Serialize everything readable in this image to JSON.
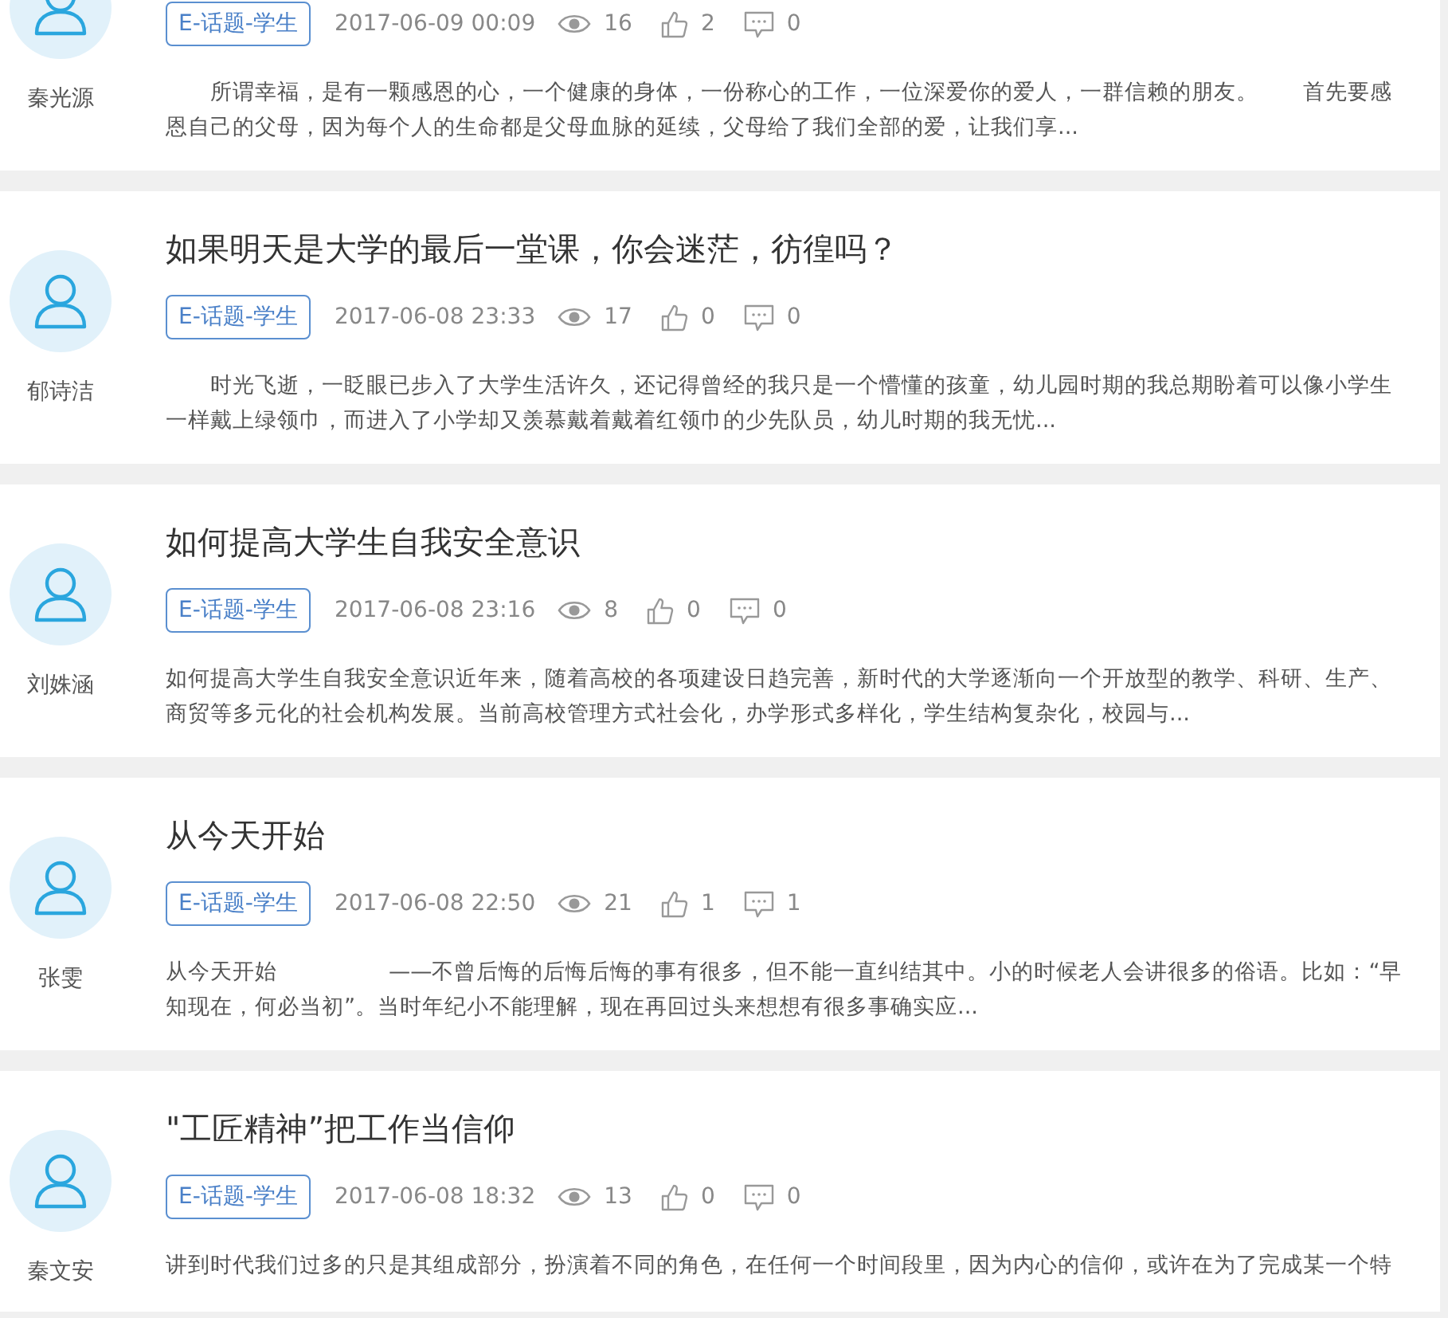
{
  "posts": [
    {
      "author": "秦光源",
      "tag": "E-话题-学生",
      "date": "2017-06-09 00:09",
      "views": "16",
      "likes": "2",
      "comments": "0",
      "excerpt": "　　所谓幸福，是有一颗感恩的心，一个健康的身体，一份称心的工作，一位深爱你的爱人，一群信赖的朋友。　　首先要感恩自己的父母，因为每个人的生命都是父母血脉的延续，父母给了我们全部的爱，让我们享..."
    },
    {
      "author": "郁诗洁",
      "title": "如果明天是大学的最后一堂课，你会迷茫，彷徨吗？",
      "tag": "E-话题-学生",
      "date": "2017-06-08 23:33",
      "views": "17",
      "likes": "0",
      "comments": "0",
      "excerpt": "　　时光飞逝，一眨眼已步入了大学生活许久，还记得曾经的我只是一个懵懂的孩童，幼儿园时期的我总期盼着可以像小学生一样戴上绿领巾，而进入了小学却又羡慕戴着戴着红领巾的少先队员，幼儿时期的我无忧..."
    },
    {
      "author": "刘姝涵",
      "title": "如何提高大学生自我安全意识",
      "tag": "E-话题-学生",
      "date": "2017-06-08 23:16",
      "views": "8",
      "likes": "0",
      "comments": "0",
      "excerpt": "如何提高大学生自我安全意识近年来，随着高校的各项建设日趋完善，新时代的大学逐渐向一个开放型的教学、科研、生产、商贸等多元化的社会机构发展。当前高校管理方式社会化，办学形式多样化，学生结构复杂化，校园与..."
    },
    {
      "author": "张雯",
      "title": "从今天开始",
      "tag": "E-话题-学生",
      "date": "2017-06-08 22:50",
      "views": "21",
      "likes": "1",
      "comments": "1",
      "excerpt": "从今天开始　　　　　——不曾后悔的后悔后悔的事有很多，但不能一直纠结其中。小的时候老人会讲很多的俗语。比如：“早知现在，何必当初”。当时年纪小不能理解，现在再回过头来想想有很多事确实应..."
    },
    {
      "author": "秦文安",
      "title": "\"工匠精神”把工作当信仰",
      "tag": "E-话题-学生",
      "date": "2017-06-08 18:32",
      "views": "13",
      "likes": "0",
      "comments": "0",
      "excerpt": "讲到时代我们过多的只是其组成部分，扮演着不同的角色，在任何一个时间段里，因为内心的信仰，或许在为了完成某一个特"
    }
  ]
}
